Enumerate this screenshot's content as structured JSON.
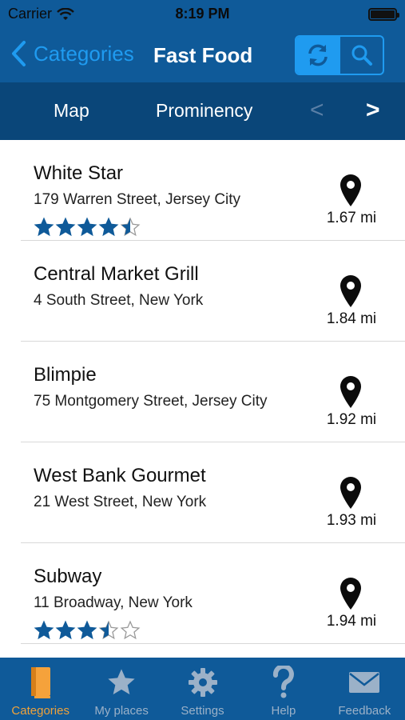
{
  "status_bar": {
    "carrier": "Carrier",
    "time": "8:19 PM"
  },
  "nav": {
    "back_label": "Categories",
    "title": "Fast Food"
  },
  "sort_bar": {
    "options": [
      "Map",
      "Prominency"
    ],
    "prev": "<",
    "next": ">"
  },
  "places": [
    {
      "name": "White Star",
      "address": "179 Warren Street, Jersey City",
      "distance": "1.67 mi",
      "rating": 4.5
    },
    {
      "name": "Central Market Grill",
      "address": "4 South Street, New York",
      "distance": "1.84 mi",
      "rating": null
    },
    {
      "name": "Blimpie",
      "address": "75 Montgomery Street, Jersey City",
      "distance": "1.92 mi",
      "rating": null
    },
    {
      "name": "West Bank Gourmet",
      "address": "21 West Street, New York",
      "distance": "1.93 mi",
      "rating": null
    },
    {
      "name": "Subway",
      "address": "11 Broadway, New York",
      "distance": "1.94 mi",
      "rating": 3.5
    }
  ],
  "tabs": [
    {
      "label": "Categories",
      "icon": "book-icon",
      "active": true
    },
    {
      "label": "My places",
      "icon": "star-icon",
      "active": false
    },
    {
      "label": "Settings",
      "icon": "gear-icon",
      "active": false
    },
    {
      "label": "Help",
      "icon": "question-icon",
      "active": false
    },
    {
      "label": "Feedback",
      "icon": "envelope-icon",
      "active": false
    }
  ],
  "colors": {
    "nav_bg": "#0f5a99",
    "sort_bg": "#0a4679",
    "accent": "#1f9bf0",
    "star": "#0f5a99",
    "active_tab": "#f0a23a"
  }
}
